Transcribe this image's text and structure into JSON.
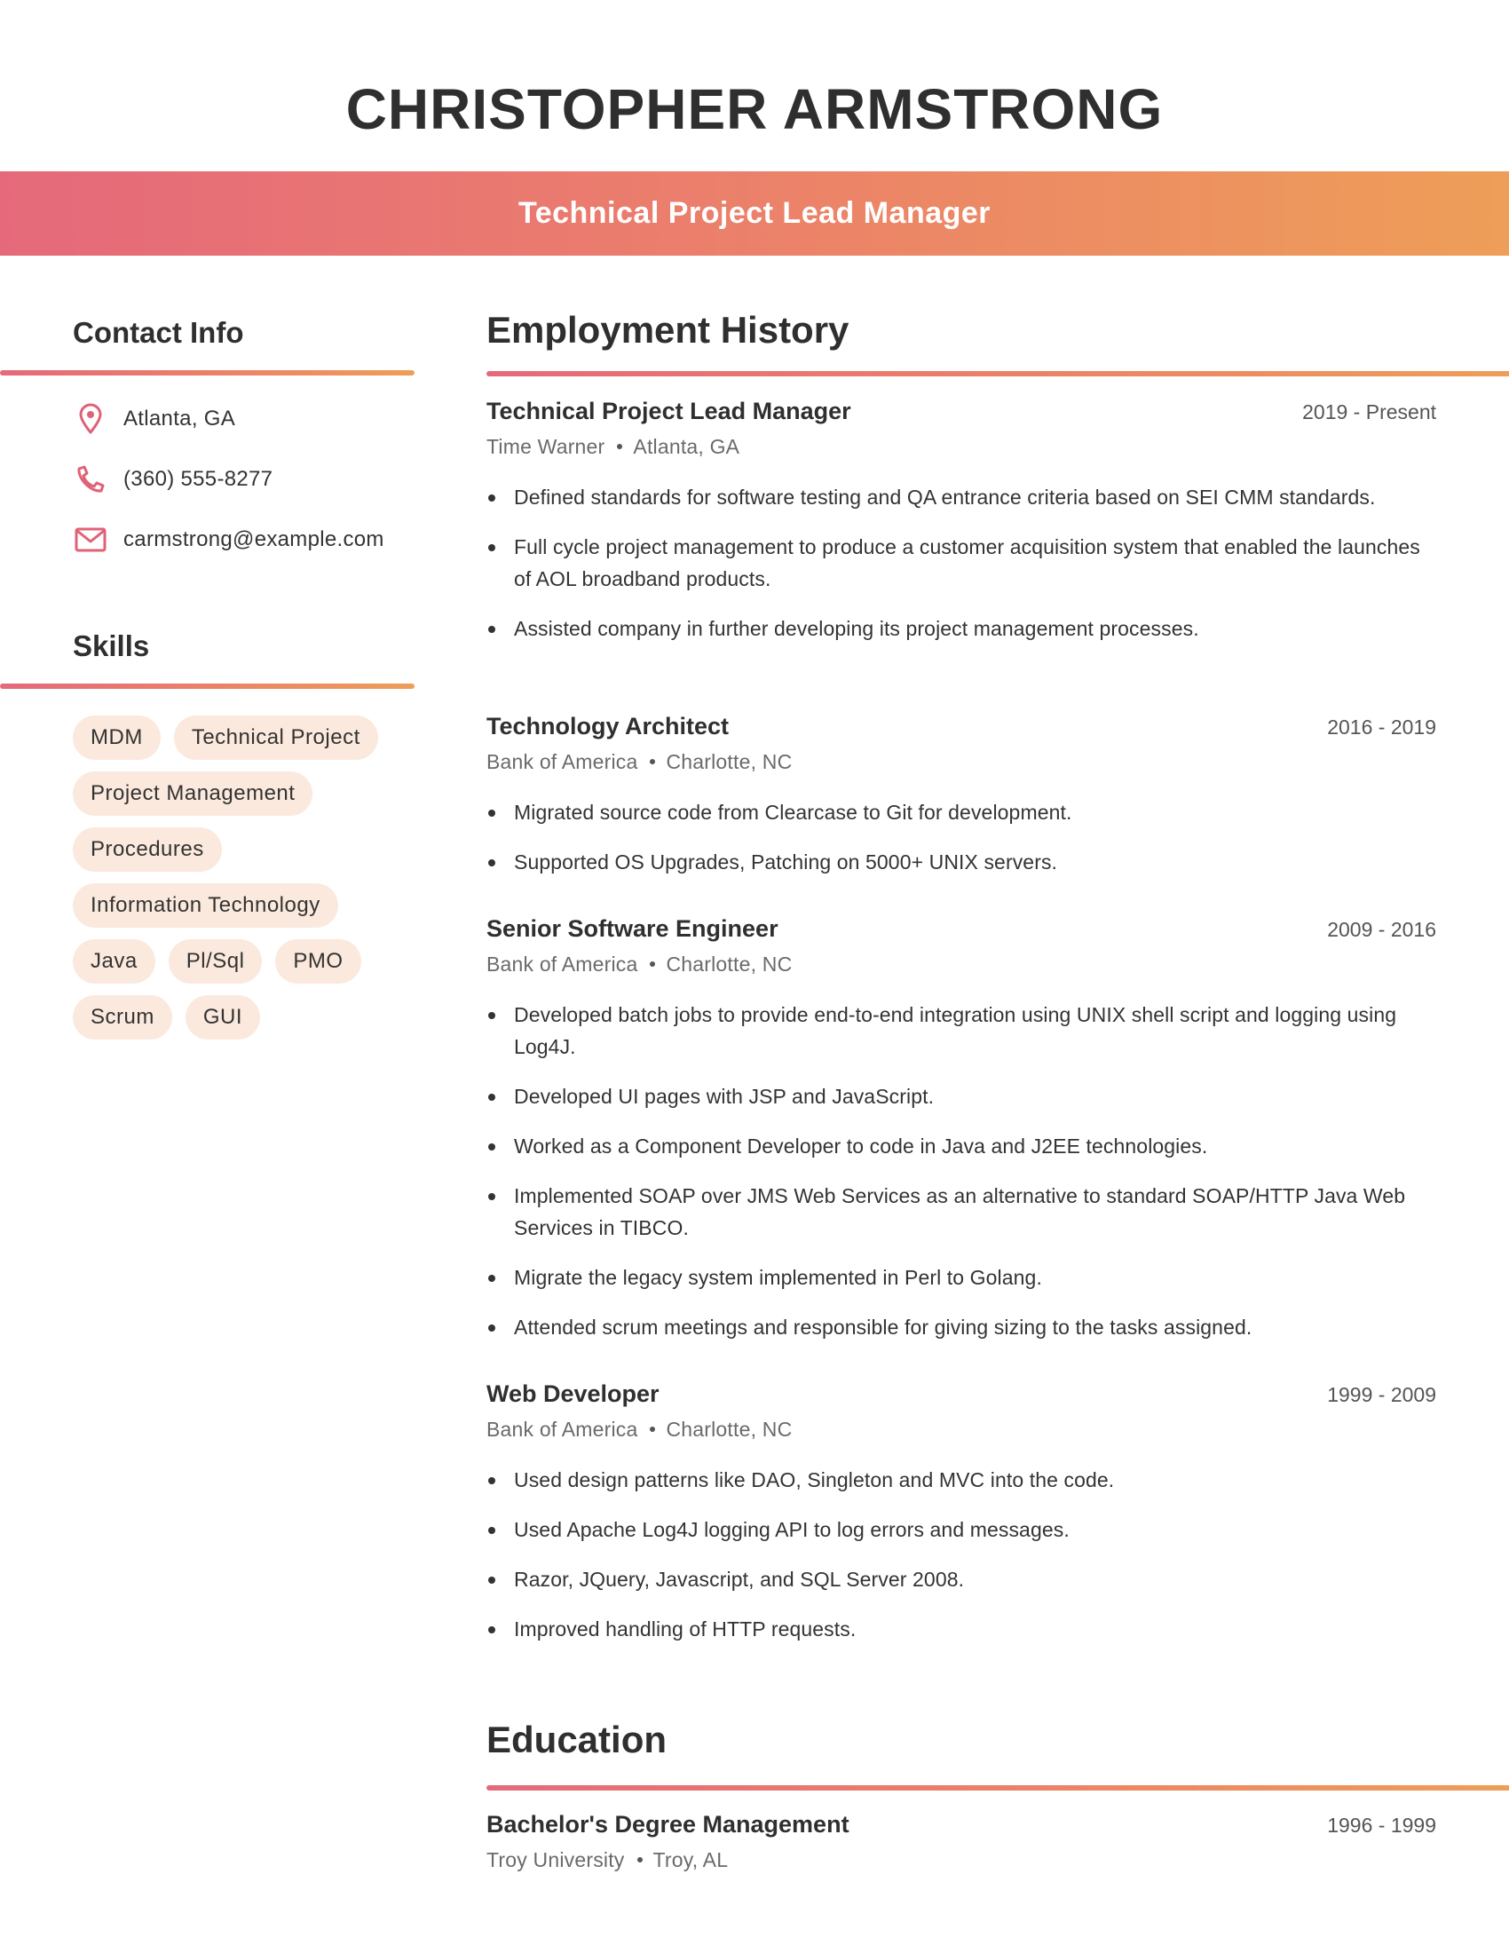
{
  "header": {
    "name": "CHRISTOPHER ARMSTRONG",
    "title": "Technical Project Lead Manager"
  },
  "colors": {
    "gradient_start": "#E5697B",
    "gradient_end": "#EE9E58",
    "icon": "#E06277",
    "chip_background": "#FBE9DD",
    "text": "#333333",
    "meta_text": "#6a6a6a"
  },
  "contact": {
    "heading": "Contact Info",
    "items": [
      {
        "icon": "map-pin-icon",
        "text": "Atlanta, GA"
      },
      {
        "icon": "phone-icon",
        "text": "(360) 555-8277"
      },
      {
        "icon": "mail-icon",
        "text": "carmstrong@example.com"
      }
    ]
  },
  "skills": {
    "heading": "Skills",
    "items": [
      "MDM",
      "Technical Project",
      "Project Management",
      "Procedures",
      "Information Technology",
      "Java",
      "Pl/Sql",
      "PMO",
      "Scrum",
      "GUI"
    ]
  },
  "employment": {
    "heading": "Employment History",
    "jobs": [
      {
        "title": "Technical Project Lead Manager",
        "dates": "2019 - Present",
        "company": "Time Warner",
        "location": "Atlanta, GA",
        "bullets": [
          "Defined standards for software testing and QA entrance criteria based on SEI CMM standards.",
          "Full cycle project management to produce a customer acquisition system that enabled the launches of AOL broadband products.",
          "Assisted company in further developing its project management processes."
        ]
      },
      {
        "title": "Technology Architect",
        "dates": "2016 - 2019",
        "company": "Bank of America",
        "location": "Charlotte, NC",
        "bullets": [
          "Migrated source code from Clearcase to Git for development.",
          "Supported OS Upgrades, Patching on 5000+ UNIX servers."
        ]
      },
      {
        "title": "Senior Software Engineer",
        "dates": "2009 - 2016",
        "company": "Bank of America",
        "location": "Charlotte, NC",
        "bullets": [
          "Developed batch jobs to provide end-to-end integration using UNIX shell script and logging using Log4J.",
          "Developed UI pages with JSP and JavaScript.",
          "Worked as a Component Developer to code in Java and J2EE technologies.",
          "Implemented SOAP over JMS Web Services as an alternative to standard SOAP/HTTP Java Web Services in TIBCO.",
          "Migrate the legacy system implemented in Perl to Golang.",
          "Attended scrum meetings and responsible for giving sizing to the tasks assigned."
        ]
      },
      {
        "title": "Web Developer",
        "dates": "1999 - 2009",
        "company": "Bank of America",
        "location": "Charlotte, NC",
        "bullets": [
          "Used design patterns like DAO, Singleton and MVC into the code.",
          "Used Apache Log4J logging API to log errors and messages.",
          "Razor, JQuery, Javascript, and SQL Server 2008.",
          "Improved handling of HTTP requests."
        ]
      }
    ]
  },
  "education": {
    "heading": "Education",
    "entries": [
      {
        "title": "Bachelor's Degree Management",
        "dates": "1996 - 1999",
        "school": "Troy University",
        "location": "Troy, AL"
      }
    ]
  }
}
